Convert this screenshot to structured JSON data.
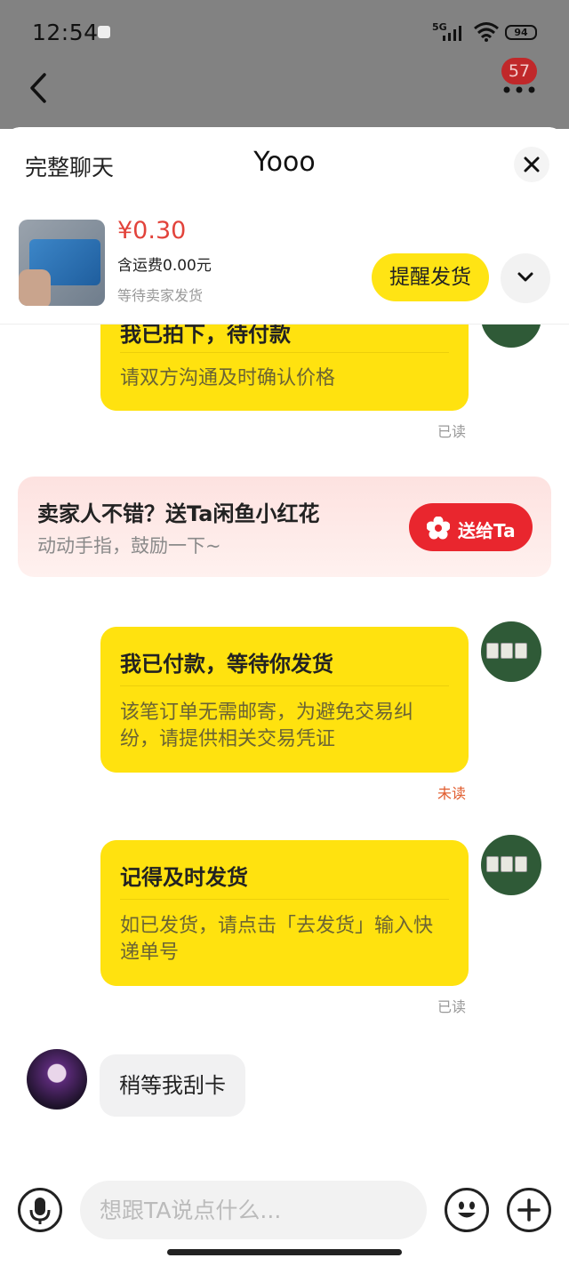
{
  "status_bar": {
    "time": "12:54",
    "network": "5G",
    "battery": "94"
  },
  "nav": {
    "badge_count": "57"
  },
  "chat_header": {
    "full_chat_label": "完整聊天",
    "peer_name": "Yooo"
  },
  "order": {
    "price": "¥0.30",
    "shipping": "含运费0.00元",
    "status": "等待卖家发货",
    "remind_button": "提醒发货"
  },
  "messages": {
    "m1": {
      "title": "我已拍下，待付款",
      "body": "请双方沟通及时确认价格",
      "read_status": "已读"
    },
    "flower": {
      "title": "卖家人不错？送Ta闲鱼小红花",
      "subtitle": "动动手指，鼓励一下~",
      "button": "送给Ta"
    },
    "m2": {
      "title": "我已付款，等待你发货",
      "body": "该笔订单无需邮寄，为避免交易纠纷，请提供相关交易凭证",
      "read_status": "未读"
    },
    "m3": {
      "title": "记得及时发货",
      "body": "如已发货，请点击「去发货」输入快递单号",
      "read_status": "已读"
    },
    "peer_reply": "稍等我刮卡"
  },
  "input": {
    "placeholder": "想跟TA说点什么..."
  },
  "colors": {
    "accent_yellow": "#ffe20f",
    "price_red": "#e2433b",
    "unread_red": "#e05a2b",
    "gift_red": "#e9262e"
  }
}
